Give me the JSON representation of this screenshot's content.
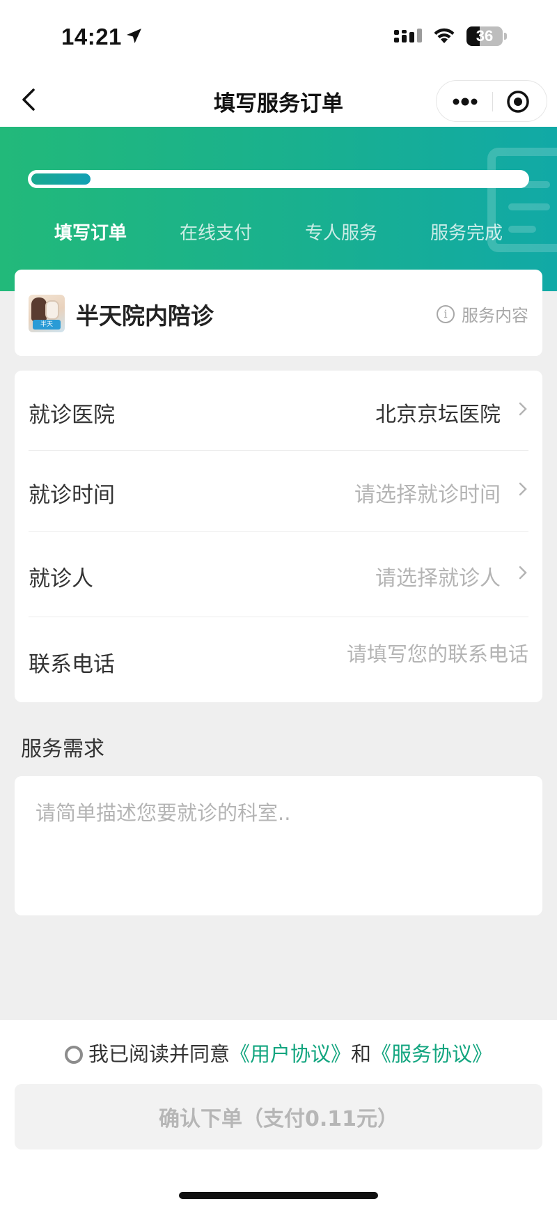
{
  "status_bar": {
    "time": "14:21",
    "battery_level": "36",
    "battery_fraction": 0.36,
    "icons": [
      "location-arrow-icon",
      "cellular-signal-icon",
      "wifi-icon",
      "battery-icon"
    ]
  },
  "nav": {
    "title": "填写服务订单",
    "back_icon": "chevron-left-icon",
    "more_icon": "more-dots-icon",
    "close_icon": "target-circle-icon"
  },
  "progress": {
    "fraction": 0.12,
    "steps": [
      {
        "label": "填写订单",
        "active": true
      },
      {
        "label": "在线支付",
        "active": false
      },
      {
        "label": "专人服务",
        "active": false
      },
      {
        "label": "服务完成",
        "active": false
      }
    ],
    "colors": {
      "start": "#22b97a",
      "end": "#11a9a6"
    }
  },
  "service": {
    "name": "半天院内陪诊",
    "thumb_tag": "半天",
    "info_label": "服务内容",
    "info_icon": "info-circle-icon"
  },
  "form": {
    "rows": [
      {
        "label": "就诊医院",
        "value": "北京京坛医院",
        "placeholder": false
      },
      {
        "label": "就诊时间",
        "value": "请选择就诊时间",
        "placeholder": true
      },
      {
        "label": "就诊人",
        "value": "请选择就诊人",
        "placeholder": true
      }
    ],
    "phone": {
      "label": "联系电话",
      "placeholder": "请填写您的联系电话",
      "value": ""
    }
  },
  "needs": {
    "title": "服务需求",
    "placeholder": "请简单描述您要就诊的科室.."
  },
  "agreement": {
    "prefix": "我已阅读并同意",
    "user_link": "《用户协议》",
    "joiner": "和",
    "service_link": "《服务协议》",
    "checked": false
  },
  "confirm": {
    "label": "确认下单（支付0.11元）"
  },
  "colors": {
    "accent": "#12a57f",
    "background": "#efefef"
  }
}
